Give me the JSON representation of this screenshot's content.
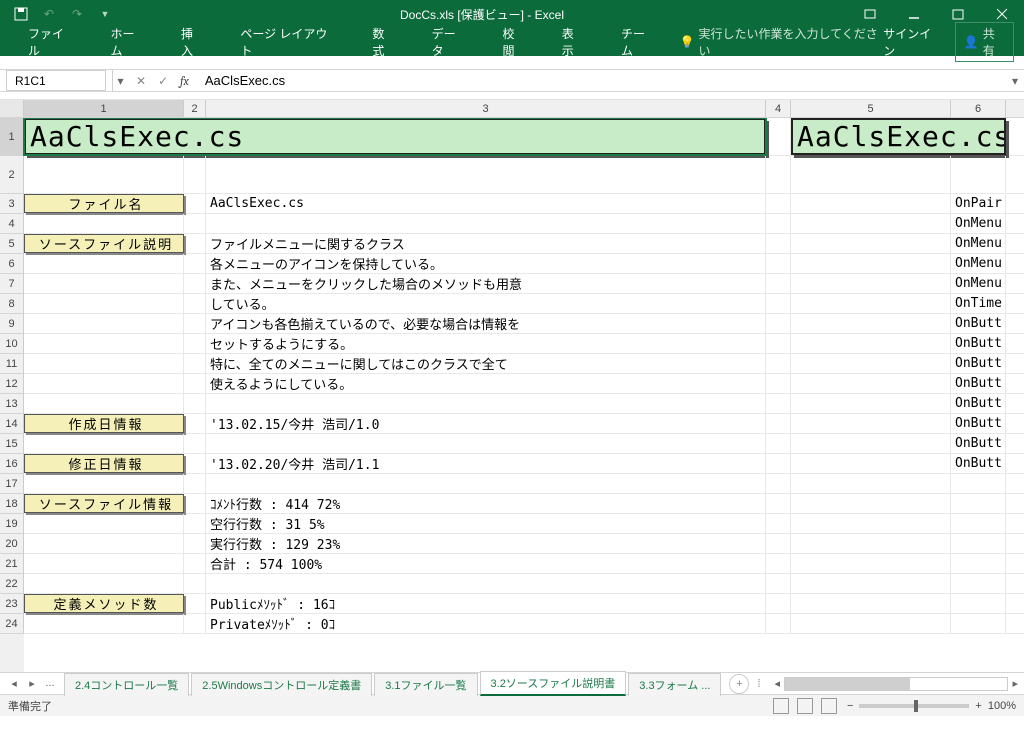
{
  "titleBar": {
    "docTitle": "DocCs.xls  [保護ビュー]  -  Excel"
  },
  "ribbon": {
    "tabs": [
      "ファイル",
      "ホーム",
      "挿入",
      "ページ レイアウト",
      "数式",
      "データ",
      "校閲",
      "表示",
      "チーム"
    ],
    "tellMe": "実行したい作業を入力してください",
    "signIn": "サインイン",
    "share": "共有"
  },
  "nameBox": "R1C1",
  "formula": "AaClsExec.cs",
  "colHeaders": [
    "1",
    "2",
    "3",
    "4",
    "5",
    "6"
  ],
  "rowHeaders": [
    "1",
    "2",
    "3",
    "4",
    "5",
    "6",
    "7",
    "8",
    "9",
    "10",
    "11",
    "12",
    "13",
    "14",
    "15",
    "16",
    "17",
    "18",
    "19",
    "20",
    "21",
    "22",
    "23",
    "24"
  ],
  "cells": {
    "title1": "AaClsExec.cs",
    "title5": "AaClsExec.cs",
    "r3": {
      "label": "ファイル名",
      "val": "AaClsExec.cs",
      "c6": "OnPair"
    },
    "r4": {
      "c6": "OnMenu"
    },
    "r5": {
      "label": "ソースファイル説明",
      "val": "ファイルメニューに関するクラス",
      "c6": "OnMenu"
    },
    "r6": {
      "val": "各メニューのアイコンを保持している。",
      "c6": "OnMenu"
    },
    "r7": {
      "val": "また、メニューをクリックした場合のメソッドも用意",
      "c6": "OnMenu"
    },
    "r8": {
      "val": "している。",
      "c6": "OnTime"
    },
    "r9": {
      "val": "アイコンも各色揃えているので、必要な場合は情報を",
      "c6": "OnButt"
    },
    "r10": {
      "val": "セットするようにする。",
      "c6": "OnButt"
    },
    "r11": {
      "val": "特に、全てのメニューに関してはこのクラスで全て",
      "c6": "OnButt"
    },
    "r12": {
      "val": "使えるようにしている。",
      "c6": "OnButt"
    },
    "r13": {
      "c6": "OnButt"
    },
    "r14": {
      "label": "作成日情報",
      "val": "'13.02.15/今井 浩司/1.0",
      "c6": "OnButt"
    },
    "r15": {
      "c6": "OnButt"
    },
    "r16": {
      "label": "修正日情報",
      "val": "'13.02.20/今井 浩司/1.1",
      "c6": "OnButt"
    },
    "r18": {
      "label": "ソースファイル情報",
      "val": "ｺﾒﾝﾄ行数 :    414    72%"
    },
    "r19": {
      "val": "空行行数 :     31     5%"
    },
    "r20": {
      "val": "実行行数 :    129    23%"
    },
    "r21": {
      "val": "合計     :    574   100%"
    },
    "r23": {
      "label": "定義メソッド数",
      "val": "Publicﾒｿｯﾄﾞ     :   16ｺ"
    },
    "r24": {
      "val": "Privateﾒｿｯﾄﾞ    :    0ｺ"
    }
  },
  "sheets": {
    "tabs": [
      "2.4コントロール一覧",
      "2.5Windowsコントロール定義書",
      "3.1ファイル一覧",
      "3.2ソースファイル説明書",
      "3.3フォーム ..."
    ],
    "active": 3,
    "ellipsis": "..."
  },
  "status": {
    "ready": "準備完了",
    "zoom": "100%"
  }
}
